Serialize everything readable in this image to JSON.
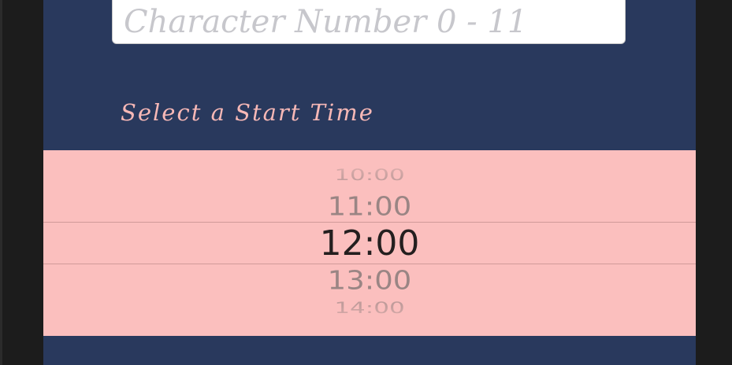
{
  "form": {
    "character_number_placeholder": "Character Number 0 - 11",
    "start_time_label": "Select a Start Time"
  },
  "time_picker": {
    "options": [
      "10:00",
      "11:00",
      "12:00",
      "13:00",
      "14:00"
    ],
    "selected": "12:00"
  },
  "colors": {
    "background": "#29395d",
    "label_accent": "#f7b8b6",
    "picker_background": "#fbbfbe"
  }
}
